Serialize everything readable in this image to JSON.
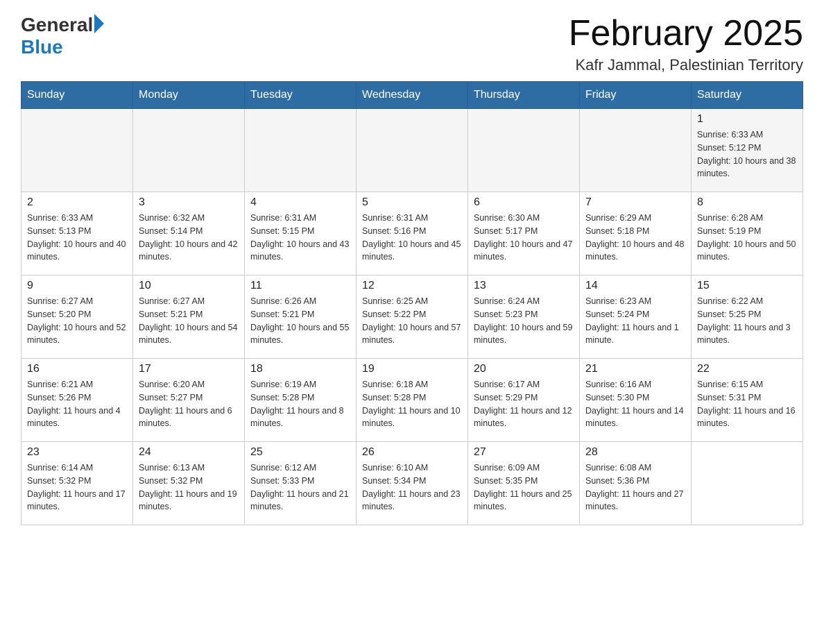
{
  "header": {
    "logo_general": "General",
    "logo_blue": "Blue",
    "calendar_title": "February 2025",
    "calendar_subtitle": "Kafr Jammal, Palestinian Territory"
  },
  "weekdays": [
    "Sunday",
    "Monday",
    "Tuesday",
    "Wednesday",
    "Thursday",
    "Friday",
    "Saturday"
  ],
  "weeks": [
    [
      {
        "day": "",
        "sunrise": "",
        "sunset": "",
        "daylight": ""
      },
      {
        "day": "",
        "sunrise": "",
        "sunset": "",
        "daylight": ""
      },
      {
        "day": "",
        "sunrise": "",
        "sunset": "",
        "daylight": ""
      },
      {
        "day": "",
        "sunrise": "",
        "sunset": "",
        "daylight": ""
      },
      {
        "day": "",
        "sunrise": "",
        "sunset": "",
        "daylight": ""
      },
      {
        "day": "",
        "sunrise": "",
        "sunset": "",
        "daylight": ""
      },
      {
        "day": "1",
        "sunrise": "Sunrise: 6:33 AM",
        "sunset": "Sunset: 5:12 PM",
        "daylight": "Daylight: 10 hours and 38 minutes."
      }
    ],
    [
      {
        "day": "2",
        "sunrise": "Sunrise: 6:33 AM",
        "sunset": "Sunset: 5:13 PM",
        "daylight": "Daylight: 10 hours and 40 minutes."
      },
      {
        "day": "3",
        "sunrise": "Sunrise: 6:32 AM",
        "sunset": "Sunset: 5:14 PM",
        "daylight": "Daylight: 10 hours and 42 minutes."
      },
      {
        "day": "4",
        "sunrise": "Sunrise: 6:31 AM",
        "sunset": "Sunset: 5:15 PM",
        "daylight": "Daylight: 10 hours and 43 minutes."
      },
      {
        "day": "5",
        "sunrise": "Sunrise: 6:31 AM",
        "sunset": "Sunset: 5:16 PM",
        "daylight": "Daylight: 10 hours and 45 minutes."
      },
      {
        "day": "6",
        "sunrise": "Sunrise: 6:30 AM",
        "sunset": "Sunset: 5:17 PM",
        "daylight": "Daylight: 10 hours and 47 minutes."
      },
      {
        "day": "7",
        "sunrise": "Sunrise: 6:29 AM",
        "sunset": "Sunset: 5:18 PM",
        "daylight": "Daylight: 10 hours and 48 minutes."
      },
      {
        "day": "8",
        "sunrise": "Sunrise: 6:28 AM",
        "sunset": "Sunset: 5:19 PM",
        "daylight": "Daylight: 10 hours and 50 minutes."
      }
    ],
    [
      {
        "day": "9",
        "sunrise": "Sunrise: 6:27 AM",
        "sunset": "Sunset: 5:20 PM",
        "daylight": "Daylight: 10 hours and 52 minutes."
      },
      {
        "day": "10",
        "sunrise": "Sunrise: 6:27 AM",
        "sunset": "Sunset: 5:21 PM",
        "daylight": "Daylight: 10 hours and 54 minutes."
      },
      {
        "day": "11",
        "sunrise": "Sunrise: 6:26 AM",
        "sunset": "Sunset: 5:21 PM",
        "daylight": "Daylight: 10 hours and 55 minutes."
      },
      {
        "day": "12",
        "sunrise": "Sunrise: 6:25 AM",
        "sunset": "Sunset: 5:22 PM",
        "daylight": "Daylight: 10 hours and 57 minutes."
      },
      {
        "day": "13",
        "sunrise": "Sunrise: 6:24 AM",
        "sunset": "Sunset: 5:23 PM",
        "daylight": "Daylight: 10 hours and 59 minutes."
      },
      {
        "day": "14",
        "sunrise": "Sunrise: 6:23 AM",
        "sunset": "Sunset: 5:24 PM",
        "daylight": "Daylight: 11 hours and 1 minute."
      },
      {
        "day": "15",
        "sunrise": "Sunrise: 6:22 AM",
        "sunset": "Sunset: 5:25 PM",
        "daylight": "Daylight: 11 hours and 3 minutes."
      }
    ],
    [
      {
        "day": "16",
        "sunrise": "Sunrise: 6:21 AM",
        "sunset": "Sunset: 5:26 PM",
        "daylight": "Daylight: 11 hours and 4 minutes."
      },
      {
        "day": "17",
        "sunrise": "Sunrise: 6:20 AM",
        "sunset": "Sunset: 5:27 PM",
        "daylight": "Daylight: 11 hours and 6 minutes."
      },
      {
        "day": "18",
        "sunrise": "Sunrise: 6:19 AM",
        "sunset": "Sunset: 5:28 PM",
        "daylight": "Daylight: 11 hours and 8 minutes."
      },
      {
        "day": "19",
        "sunrise": "Sunrise: 6:18 AM",
        "sunset": "Sunset: 5:28 PM",
        "daylight": "Daylight: 11 hours and 10 minutes."
      },
      {
        "day": "20",
        "sunrise": "Sunrise: 6:17 AM",
        "sunset": "Sunset: 5:29 PM",
        "daylight": "Daylight: 11 hours and 12 minutes."
      },
      {
        "day": "21",
        "sunrise": "Sunrise: 6:16 AM",
        "sunset": "Sunset: 5:30 PM",
        "daylight": "Daylight: 11 hours and 14 minutes."
      },
      {
        "day": "22",
        "sunrise": "Sunrise: 6:15 AM",
        "sunset": "Sunset: 5:31 PM",
        "daylight": "Daylight: 11 hours and 16 minutes."
      }
    ],
    [
      {
        "day": "23",
        "sunrise": "Sunrise: 6:14 AM",
        "sunset": "Sunset: 5:32 PM",
        "daylight": "Daylight: 11 hours and 17 minutes."
      },
      {
        "day": "24",
        "sunrise": "Sunrise: 6:13 AM",
        "sunset": "Sunset: 5:32 PM",
        "daylight": "Daylight: 11 hours and 19 minutes."
      },
      {
        "day": "25",
        "sunrise": "Sunrise: 6:12 AM",
        "sunset": "Sunset: 5:33 PM",
        "daylight": "Daylight: 11 hours and 21 minutes."
      },
      {
        "day": "26",
        "sunrise": "Sunrise: 6:10 AM",
        "sunset": "Sunset: 5:34 PM",
        "daylight": "Daylight: 11 hours and 23 minutes."
      },
      {
        "day": "27",
        "sunrise": "Sunrise: 6:09 AM",
        "sunset": "Sunset: 5:35 PM",
        "daylight": "Daylight: 11 hours and 25 minutes."
      },
      {
        "day": "28",
        "sunrise": "Sunrise: 6:08 AM",
        "sunset": "Sunset: 5:36 PM",
        "daylight": "Daylight: 11 hours and 27 minutes."
      },
      {
        "day": "",
        "sunrise": "",
        "sunset": "",
        "daylight": ""
      }
    ]
  ]
}
